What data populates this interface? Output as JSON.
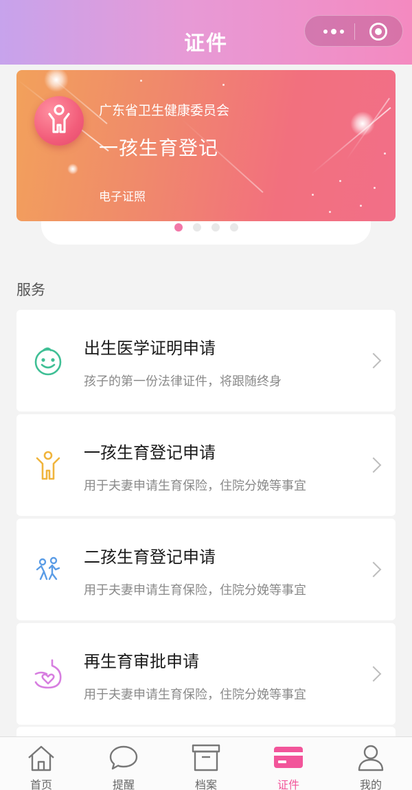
{
  "header": {
    "title": "证件"
  },
  "banner": {
    "authority": "广东省卫生健康委员会",
    "title": "一孩生育登记",
    "subtitle": "电子证照",
    "page_count": 4,
    "active_page": 1
  },
  "section": {
    "title": "服务"
  },
  "services": [
    {
      "title": "出生医学证明申请",
      "desc": "孩子的第一份法律证件，将跟随终身",
      "icon": "baby-face-icon",
      "color": "#3fbf95"
    },
    {
      "title": "一孩生育登记申请",
      "desc": "用于夫妻申请生育保险，住院分娩等事宜",
      "icon": "child-icon",
      "color": "#f0b43c"
    },
    {
      "title": "二孩生育登记申请",
      "desc": "用于夫妻申请生育保险，住院分娩等事宜",
      "icon": "two-children-icon",
      "color": "#5a9ce6"
    },
    {
      "title": "再生育审批申请",
      "desc": "用于夫妻申请生育保险，住院分娩等事宜",
      "icon": "pregnancy-icon",
      "color": "#d77ee0"
    }
  ],
  "tabs": [
    {
      "label": "首页",
      "icon": "home-icon"
    },
    {
      "label": "提醒",
      "icon": "chat-bubble-icon"
    },
    {
      "label": "档案",
      "icon": "archive-box-icon"
    },
    {
      "label": "证件",
      "icon": "card-icon",
      "active": true
    },
    {
      "label": "我的",
      "icon": "user-icon"
    }
  ],
  "colors": {
    "accent": "#f2559a",
    "header_start": "#c7a3ec",
    "header_end": "#f48ac0"
  }
}
